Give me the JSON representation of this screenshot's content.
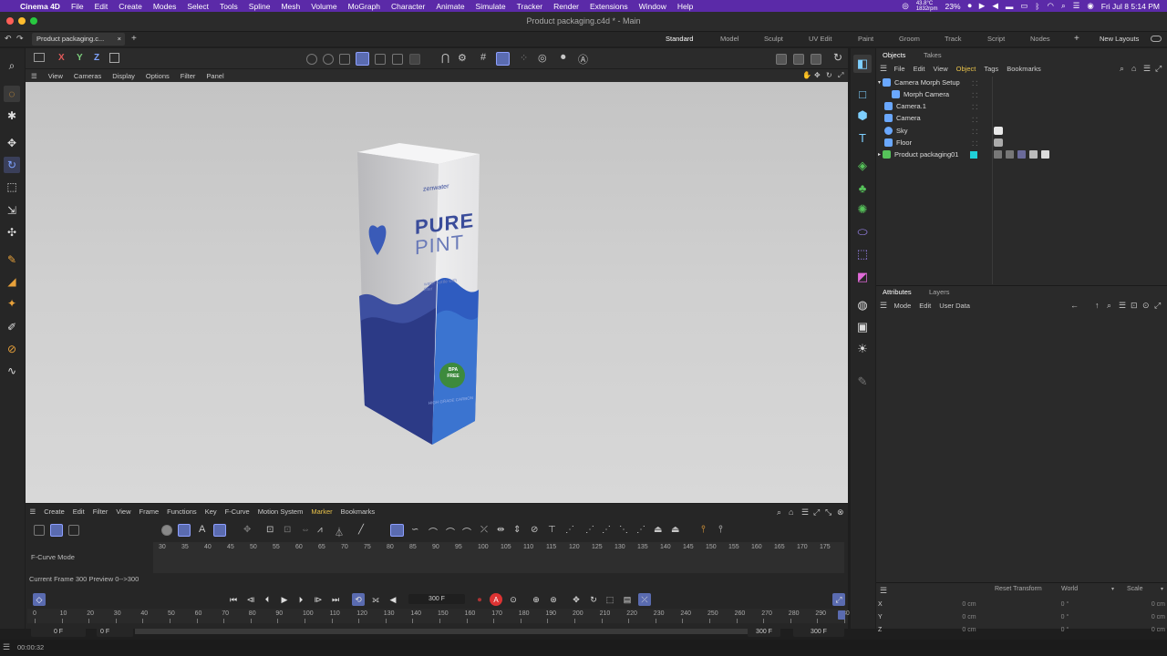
{
  "menubar": {
    "apple_icon": "apple-icon",
    "app": "Cinema 4D",
    "items": [
      "File",
      "Edit",
      "Create",
      "Modes",
      "Select",
      "Tools",
      "Spline",
      "Mesh",
      "Volume",
      "MoGraph",
      "Character",
      "Animate",
      "Simulate",
      "Tracker",
      "Render",
      "Extensions",
      "Window",
      "Help"
    ],
    "status_temp": "43.8°C",
    "status_rpm": "1832rpm",
    "status_pct": "23%",
    "clock": "Fri Jul 8  5:14 PM"
  },
  "window": {
    "title": "Product packaging.c4d * - Main",
    "doc_tab": "Product packaging.c...",
    "layouts": [
      "Standard",
      "Model",
      "Sculpt",
      "UV Edit",
      "Paint",
      "Groom",
      "Track",
      "Script",
      "Nodes"
    ],
    "new_layouts": "New Layouts",
    "active_layout": "Standard"
  },
  "viewport": {
    "axes": [
      "X",
      "Y",
      "Z"
    ],
    "menu": [
      "View",
      "Cameras",
      "Display",
      "Options",
      "Filter",
      "Panel"
    ]
  },
  "objects_panel": {
    "tabs": [
      "Objects",
      "Takes"
    ],
    "menu": [
      "File",
      "Edit",
      "View",
      "Object",
      "Tags",
      "Bookmarks"
    ],
    "active_menu": "Object",
    "items": [
      {
        "label": "Camera Morph Setup",
        "indent": 0
      },
      {
        "label": "Morph Camera",
        "indent": 1
      },
      {
        "label": "Camera.1",
        "indent": 0
      },
      {
        "label": "Camera",
        "indent": 0
      },
      {
        "label": "Sky",
        "indent": 0
      },
      {
        "label": "Floor",
        "indent": 0
      },
      {
        "label": "Product packaging01",
        "indent": 0
      }
    ]
  },
  "attributes_panel": {
    "tabs": [
      "Attributes",
      "Layers"
    ],
    "menu": [
      "Mode",
      "Edit",
      "User Data"
    ]
  },
  "coordinates": {
    "reset": "Reset Transform",
    "space": "World",
    "scale": "Scale",
    "rows": [
      {
        "axis": "X",
        "pos": "0 cm",
        "rot": "0 °",
        "size": "0 cm"
      },
      {
        "axis": "Y",
        "pos": "0 cm",
        "rot": "0 °",
        "size": "0 cm"
      },
      {
        "axis": "Z",
        "pos": "0 cm",
        "rot": "0 °",
        "size": "0 cm"
      }
    ]
  },
  "timeline": {
    "menu": [
      "Create",
      "Edit",
      "Filter",
      "View",
      "Frame",
      "Functions",
      "Key",
      "F-Curve",
      "Motion System",
      "Marker",
      "Bookmarks"
    ],
    "active_menu": "Marker",
    "mode_label": "F-Curve Mode",
    "ruler_top": [
      "30",
      "35",
      "40",
      "45",
      "50",
      "55",
      "60",
      "65",
      "70",
      "75",
      "80",
      "85",
      "90",
      "95",
      "100",
      "105",
      "110",
      "115",
      "120",
      "125",
      "130",
      "135",
      "140",
      "145",
      "150",
      "155",
      "160",
      "165",
      "170",
      "175"
    ],
    "status": "Current Frame  300  Preview  0-->300",
    "frame_field": "300 F",
    "ruler_bottom": [
      "0",
      "10",
      "20",
      "30",
      "40",
      "50",
      "60",
      "70",
      "80",
      "90",
      "100",
      "110",
      "120",
      "130",
      "140",
      "150",
      "160",
      "170",
      "180",
      "190",
      "200",
      "210",
      "220",
      "230",
      "240",
      "250",
      "260",
      "270",
      "280",
      "290",
      "30"
    ],
    "start_a": "0 F",
    "start_b": "0 F",
    "end_a": "300 F",
    "end_b": "300 F"
  },
  "bottom": {
    "time": "00:00:32"
  },
  "box": {
    "brand": "zenwater",
    "title1": "PURE",
    "title2": "PINT",
    "tagline": "water bottle with filter",
    "badge1": "BPA",
    "badge2": "FREE",
    "bottom_text": "HIGH GRADE CARBON"
  }
}
